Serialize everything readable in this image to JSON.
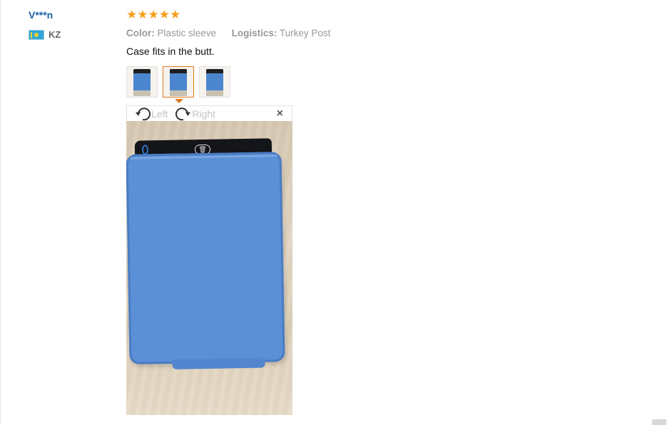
{
  "reviewer": {
    "name": "V***n",
    "country_code": "KZ",
    "flag_icon": "kazakhstan-flag-icon"
  },
  "review": {
    "rating": 5,
    "rating_max": 5,
    "stars": [
      "★",
      "★",
      "★",
      "★",
      "★"
    ],
    "color_label": "Color:",
    "color_value": "Plastic sleeve",
    "logistics_label": "Logistics:",
    "logistics_value": "Turkey Post",
    "text": "Case fits in the butt."
  },
  "photos": {
    "count": 3,
    "selected_index": 1
  },
  "viewer": {
    "rotate_left_label": "Left",
    "rotate_right_label": "Right",
    "close_symbol": "×"
  },
  "colors": {
    "accent_orange": "#e07a1f",
    "star_color": "#f6a01a",
    "name_blue": "#1a5fa8"
  }
}
